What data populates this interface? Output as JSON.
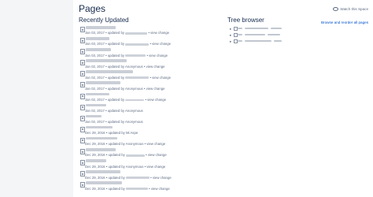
{
  "page": {
    "title": "Pages",
    "watch_label": "Watch this Space",
    "watch_icon": "eye-icon"
  },
  "recent": {
    "heading": "Recently Updated",
    "items": [
      {
        "date": "Jan 03, 2017",
        "by_prefix": "• updated by",
        "author": "",
        "view_change": "• view change"
      },
      {
        "date": "Jan 03, 2017",
        "by_prefix": "• updated by",
        "author": "",
        "view_change": "• view change"
      },
      {
        "date": "Jan 03, 2017",
        "by_prefix": "• updated by",
        "author": "",
        "view_change": "• view change"
      },
      {
        "date": "Jan 02, 2017",
        "by_prefix": "• updated by",
        "author": "Anonymous",
        "view_change": "• view change"
      },
      {
        "date": "Jan 02, 2017",
        "by_prefix": "• updated by",
        "author": "",
        "view_change": "• view change"
      },
      {
        "date": "Jan 02, 2017",
        "by_prefix": "• updated by",
        "author": "Anonymous",
        "view_change": "• view change"
      },
      {
        "date": "Jan 02, 2017",
        "by_prefix": "• updated by",
        "author": "",
        "view_change": "• view change"
      },
      {
        "date": "Jan 02, 2017",
        "by_prefix": "• updated by",
        "author": "Anonymous",
        "view_change": ""
      },
      {
        "date": "Jan 02, 2017",
        "by_prefix": "• updated by",
        "author": "Anonymous",
        "view_change": ""
      },
      {
        "date": "Dec 29, 2016",
        "by_prefix": "• updated by",
        "author": "Mi Aspe",
        "view_change": ""
      },
      {
        "date": "Dec 29, 2016",
        "by_prefix": "• updated by",
        "author": "Anonymous",
        "view_change": "• view change"
      },
      {
        "date": "Dec 29, 2016",
        "by_prefix": "• updated by",
        "author": "",
        "view_change": "• view change"
      },
      {
        "date": "Dec 29, 2016",
        "by_prefix": "• updated by",
        "author": "Anonymous",
        "view_change": "• view change"
      },
      {
        "date": "Dec 29, 2016",
        "by_prefix": "• updated by",
        "author": "",
        "view_change": "• view change"
      },
      {
        "date": "Dec 29, 2016",
        "by_prefix": "• updated by",
        "author": "",
        "view_change": "• view change"
      }
    ]
  },
  "tree": {
    "heading": "Tree browser",
    "browse_link": "Browse and reorder all pages",
    "nodes": [
      {
        "toggle": "▸",
        "label": ""
      },
      {
        "toggle": "▸",
        "label": ""
      },
      {
        "toggle": "▸",
        "label": ""
      }
    ]
  }
}
